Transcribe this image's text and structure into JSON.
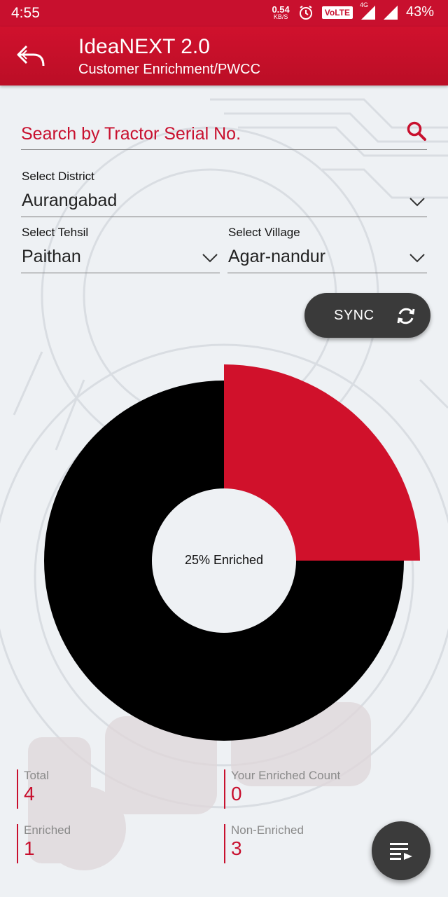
{
  "status_bar": {
    "time": "4:55",
    "speed_value": "0.54",
    "speed_unit": "KB/S",
    "volte": "VoLTE",
    "network": "4G",
    "battery": "43%",
    "icons": [
      "alarm-icon",
      "signal-icon",
      "battery-icon"
    ]
  },
  "header": {
    "title": "IdeaNEXT 2.0",
    "subtitle": "Customer Enrichment/PWCC",
    "back_icon": "back-arrow-icon"
  },
  "search": {
    "placeholder": "Search by Tractor Serial No.",
    "icon": "search-icon"
  },
  "filters": {
    "district": {
      "label": "Select District",
      "value": "Aurangabad"
    },
    "tehsil": {
      "label": "Select Tehsil",
      "value": "Paithan"
    },
    "village": {
      "label": "Select Village",
      "value": "Agar-nandur"
    }
  },
  "sync_button": {
    "label": "SYNC",
    "icon": "sync-icon"
  },
  "chart_data": {
    "type": "pie",
    "style": "donut",
    "center_label": "25% Enriched",
    "slices": [
      {
        "label": "Enriched",
        "value": 1,
        "color": "#d0112b",
        "exploded": true
      },
      {
        "label": "Non-Enriched",
        "value": 3,
        "color": "#000000"
      }
    ]
  },
  "stats": {
    "total": {
      "label": "Total",
      "value": "4"
    },
    "your_enriched": {
      "label": "Your Enriched Count",
      "value": "0"
    },
    "enriched": {
      "label": "Enriched",
      "value": "1"
    },
    "non_enriched": {
      "label": "Non-Enriched",
      "value": "3"
    }
  },
  "fab": {
    "icon": "playlist-icon"
  },
  "colors": {
    "primary": "#c8102e",
    "dark": "#3a3a3a"
  }
}
